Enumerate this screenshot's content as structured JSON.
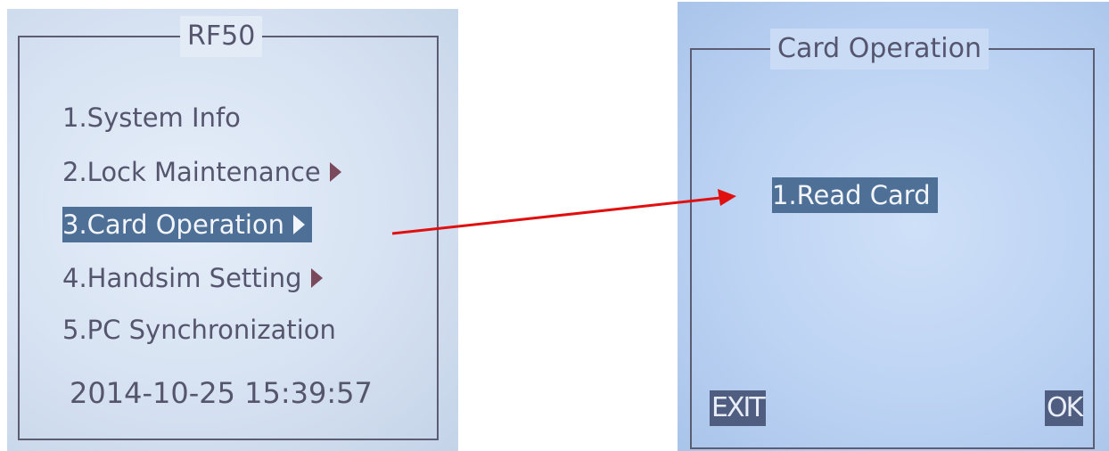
{
  "left_screen": {
    "title": "RF50",
    "menu": [
      {
        "label": "1.System Info",
        "submenu": false,
        "selected": false
      },
      {
        "label": "2.Lock Maintenance",
        "submenu": true,
        "selected": false
      },
      {
        "label": "3.Card Operation",
        "submenu": true,
        "selected": true
      },
      {
        "label": "4.Handsim Setting",
        "submenu": true,
        "selected": false
      },
      {
        "label": "5.PC Synchronization",
        "submenu": false,
        "selected": false
      }
    ],
    "datetime": "2014-10-25  15:39:57"
  },
  "right_screen": {
    "title": "Card Operation",
    "menu": [
      {
        "label": "1.Read Card",
        "selected": true
      }
    ],
    "exit_label": "EXIT",
    "ok_label": "OK"
  },
  "arrow": {
    "color": "#e01010",
    "from": "3.Card Operation",
    "to": "Card Operation"
  },
  "colors": {
    "highlight": "#4e6f96",
    "text": "#55566e",
    "submenu_arrow": "#7a4a5c"
  }
}
